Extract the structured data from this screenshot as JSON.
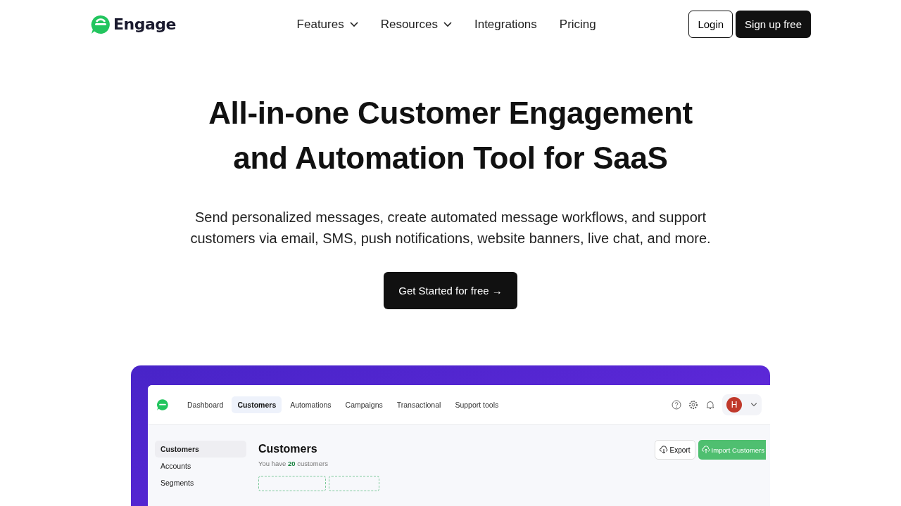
{
  "header": {
    "logo": "Engage",
    "nav": [
      {
        "label": "Features",
        "dropdown": true
      },
      {
        "label": "Resources",
        "dropdown": true
      },
      {
        "label": "Integrations",
        "dropdown": false
      },
      {
        "label": "Pricing",
        "dropdown": false
      }
    ],
    "login": "Login",
    "signup": "Sign up free"
  },
  "hero": {
    "title": "All-in-one Customer Engagement and Automation Tool for SaaS",
    "subtitle": "Send personalized messages, create automated message workflows, and support customers via email, SMS, push notifications, website banners, live chat, and more.",
    "cta": "Get Started for free →"
  },
  "app": {
    "tabs": [
      {
        "label": "Dashboard",
        "selected": false
      },
      {
        "label": "Customers",
        "selected": true
      },
      {
        "label": "Automations",
        "selected": false
      },
      {
        "label": "Campaigns",
        "selected": false
      },
      {
        "label": "Transactional",
        "selected": false
      },
      {
        "label": "Support tools",
        "selected": false
      }
    ],
    "avatar": "H",
    "sidebar": [
      {
        "label": "Customers",
        "selected": true
      },
      {
        "label": "Accounts",
        "selected": false
      },
      {
        "label": "Segments",
        "selected": false
      }
    ],
    "page_title": "Customers",
    "summary": "You have **20** customers",
    "export": "Export",
    "import": "Import Customers"
  }
}
